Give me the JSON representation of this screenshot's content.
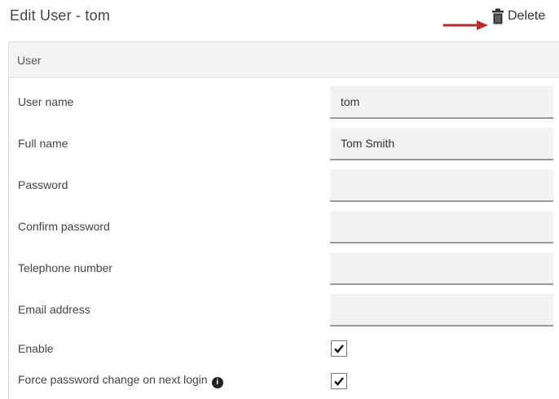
{
  "header": {
    "title": "Edit User - tom",
    "delete_label": "Delete"
  },
  "panel": {
    "section_title": "User"
  },
  "fields": {
    "user_name": {
      "label": "User name",
      "value": "tom"
    },
    "full_name": {
      "label": "Full name",
      "value": "Tom Smith"
    },
    "password": {
      "label": "Password",
      "value": ""
    },
    "confirm_password": {
      "label": "Confirm password",
      "value": ""
    },
    "telephone": {
      "label": "Telephone number",
      "value": ""
    },
    "email": {
      "label": "Email address",
      "value": ""
    }
  },
  "checkboxes": {
    "enable": {
      "label": "Enable",
      "checked": true
    },
    "force_password_change": {
      "label": "Force password change on next login",
      "checked": true
    }
  },
  "icons": {
    "delete": "trash-icon",
    "arrow": "arrow-right-icon",
    "info": "info-icon"
  },
  "colors": {
    "arrow": "#c0272d",
    "field_bg": "#f2f2f2",
    "field_underline": "#9a9a9a"
  }
}
